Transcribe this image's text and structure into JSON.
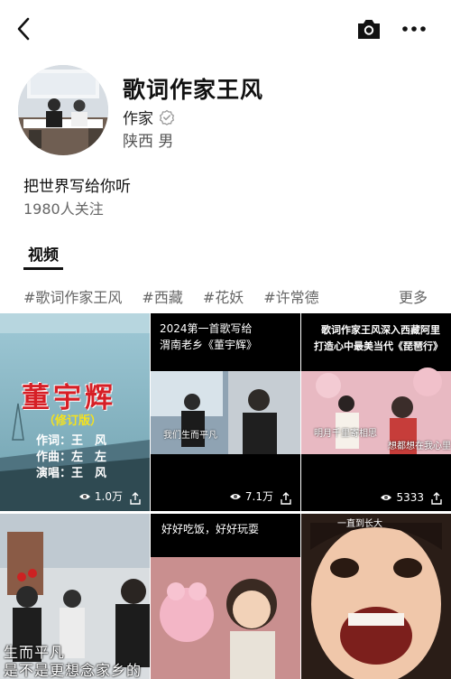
{
  "profile": {
    "name": "歌词作家王风",
    "role": "作家",
    "location": "陕西 男",
    "bio": "把世界写给你听",
    "followers": "1980人关注"
  },
  "tabs": [
    {
      "label": "视频",
      "active": true
    }
  ],
  "tags": [
    "#歌词作家王风",
    "#西藏",
    "#花妖",
    "#许常德"
  ],
  "tags_more": "更多",
  "videos": [
    {
      "title": "董宇辉",
      "subtitle": "（修订版）",
      "credits": [
        "作词：王　风",
        "作曲：左　左",
        "演唱：王　风"
      ],
      "views": "1.0万"
    },
    {
      "caption_top": [
        "2024第一首歌写给",
        "渭南老乡《董宇辉》"
      ],
      "overlay": [
        "我们生而平凡",
        "是不是更想念家乡的"
      ],
      "views": "7.1万"
    },
    {
      "caption_top": [
        "歌词作家王风深入西藏阿里",
        "打造心中最美当代《琵琶行》"
      ],
      "overlay": [
        "明月千里寄相思",
        "想都想在我心里"
      ],
      "views": "5333"
    },
    {
      "overlay": [
        "生而平凡",
        "是不是更想念家乡的"
      ]
    },
    {
      "caption_top": [
        "好好吃饭，好好玩耍"
      ]
    },
    {
      "caption_top": [
        "一直到长大"
      ]
    }
  ],
  "icons": {
    "back": "back-arrow-icon",
    "camera": "camera-icon",
    "more": "more-dots-icon",
    "verified": "verified-icon",
    "eye": "eye-icon",
    "share": "share-icon"
  }
}
